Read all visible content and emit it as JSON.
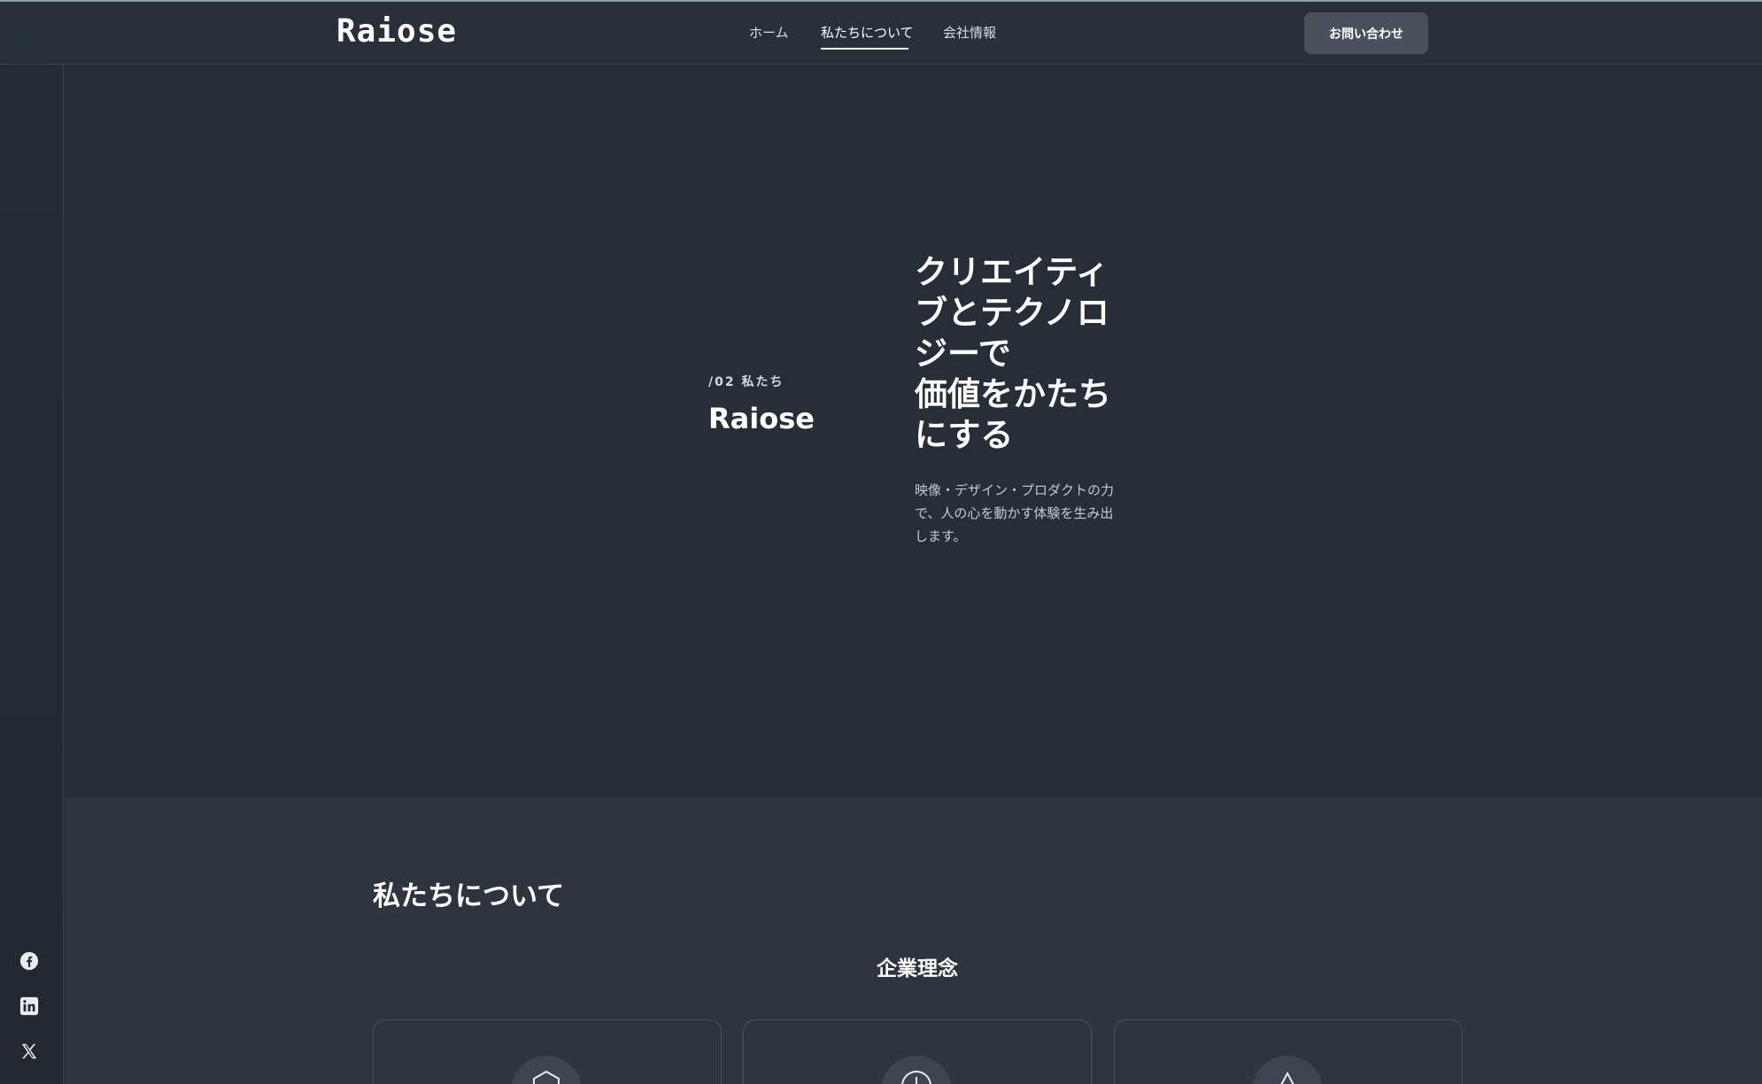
{
  "header": {
    "logo": "Raiose",
    "nav": [
      {
        "label": "ホーム",
        "active": false
      },
      {
        "label": "私たちについて",
        "active": true
      },
      {
        "label": "会社情報",
        "active": false
      }
    ],
    "cta_label": "お問い合わせ"
  },
  "sidebar": {
    "social": [
      "facebook-icon",
      "linkedin-icon",
      "x-icon"
    ]
  },
  "hero": {
    "label": "/02 私たち",
    "name": "Raiose",
    "title": "クリエイティ\nブとテクノロ\nジーで\n価値をかたち\nにする",
    "description": "映像・デザイン・プロダクトの力\nで、人の心を動かす体験を生み出\nします。"
  },
  "about": {
    "title": "私たちについて",
    "philosophy": "企業理念",
    "cards": [
      {
        "icon": "hexagon-icon"
      },
      {
        "icon": "compass-icon"
      },
      {
        "icon": "triangle-icon"
      }
    ]
  },
  "colors": {
    "background": "#282e37",
    "header": "#2a3039",
    "section": "#2f353f",
    "button": "#4a515c"
  }
}
